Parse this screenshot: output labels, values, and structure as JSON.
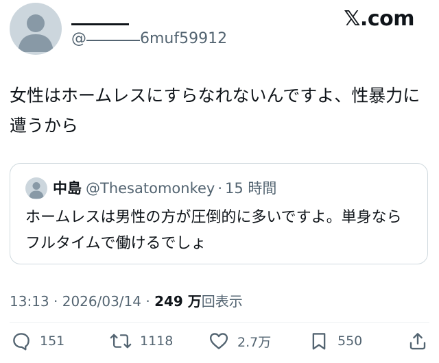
{
  "author": {
    "handle_suffix": "6muf59912",
    "handle_prefix": "@"
  },
  "brand": "𝕏.com",
  "tweet": {
    "text": "女性はホームレスにすらなれないんですよ、性暴力に遭うから"
  },
  "quoted_tweet": {
    "name": "中島",
    "handle": "@Thesatomonkey",
    "separator": "·",
    "time": "15 時間",
    "text": "ホームレスは男性の方が圧倒的に多いですよ。単身ならフルタイムで働けるでしょ"
  },
  "meta": {
    "time": "13:13",
    "sep1": "·",
    "date": "2026/03/14",
    "sep2": "·",
    "views_count": "249 万",
    "views_label": "回表示"
  },
  "actions": {
    "replies": "151",
    "reposts": "1118",
    "likes": "2.7万",
    "bookmarks": "550"
  },
  "colors": {
    "text_primary": "#0f1419",
    "text_secondary": "#536471",
    "border": "#cfd9de",
    "avatar_bg": "#ccd6dd"
  }
}
